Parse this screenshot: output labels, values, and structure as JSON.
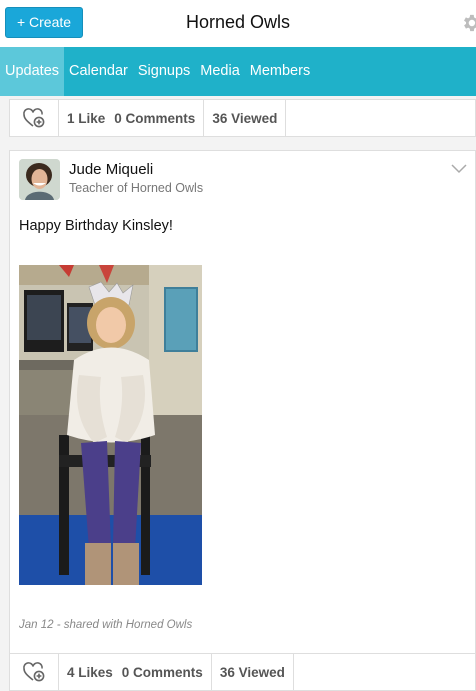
{
  "header": {
    "create_label": "+ Create",
    "title": "Horned Owls",
    "settings_icon": "gear-icon"
  },
  "tabs": [
    {
      "label": "Updates",
      "active": true
    },
    {
      "label": "Calendar",
      "active": false
    },
    {
      "label": "Signups",
      "active": false
    },
    {
      "label": "Media",
      "active": false
    },
    {
      "label": "Members",
      "active": false
    }
  ],
  "top_post_stats": {
    "likes": "1 Like",
    "comments": "0 Comments",
    "views": "36 Viewed"
  },
  "post": {
    "author": "Jude Miqueli",
    "role": "Teacher of Horned Owls",
    "text": "Happy Birthday Kinsley!",
    "meta": "Jan 12 - shared with Horned Owls",
    "stats": {
      "likes": "4 Likes",
      "comments": "0 Comments",
      "views": "36 Viewed"
    }
  },
  "colors": {
    "create_button": "#1aa7d9",
    "tab_bar": "#1fb1c9",
    "tab_active": "#5cc8da"
  }
}
